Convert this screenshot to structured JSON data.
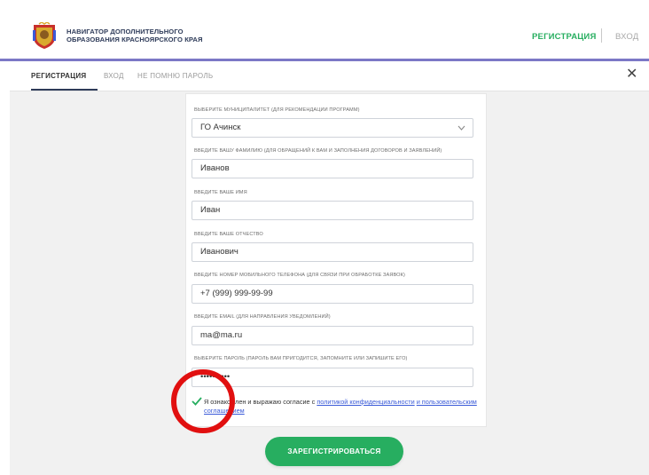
{
  "header": {
    "logo_line1": "НАВИГАТОР ДОПОЛНИТЕЛЬНОГО",
    "logo_line2": "ОБРАЗОВАНИЯ КРАСНОЯРСКОГО КРАЯ",
    "nav_register": "РЕГИСТРАЦИЯ",
    "nav_login": "ВХОД"
  },
  "tabs": {
    "register": "РЕГИСТРАЦИЯ",
    "login": "ВХОД",
    "forgot": "НЕ ПОМНЮ ПАРОЛЬ",
    "close": "✕"
  },
  "form": {
    "municipality": {
      "label": "ВЫБЕРИТЕ МУНИЦИПАЛИТЕТ (ДЛЯ РЕКОМЕНДАЦИИ ПРОГРАММ)",
      "value": "ГО Ачинск"
    },
    "last_name": {
      "label": "ВВЕДИТЕ ВАШУ ФАМИЛИЮ (ДЛЯ ОБРАЩЕНИЙ К ВАМ И ЗАПОЛНЕНИЯ ДОГОВОРОВ И ЗАЯВЛЕНИЙ)",
      "value": "Иванов"
    },
    "first_name": {
      "label": "ВВЕДИТЕ ВАШЕ ИМЯ",
      "value": "Иван"
    },
    "patronymic": {
      "label": "ВВЕДИТЕ ВАШЕ ОТЧЕСТВО",
      "value": "Иванович"
    },
    "phone": {
      "label": "ВВЕДИТЕ НОМЕР МОБИЛЬНОГО ТЕЛЕФОНА (ДЛЯ СВЯЗИ ПРИ ОБРАБОТКЕ ЗАЯВОК)",
      "value": "+7 (999) 999-99-99"
    },
    "email": {
      "label": "ВВЕДИТЕ EMAIL (ДЛЯ НАПРАВЛЕНИЯ УВЕДОМЛЕНИЙ)",
      "value": "ma@ma.ru"
    },
    "password": {
      "label": "ВЫБЕРИТЕ ПАРОЛЬ (ПАРОЛЬ ВАМ ПРИГОДИТСЯ, ЗАПОМНИТЕ ИЛИ ЗАПИШИТЕ ЕГО)",
      "value": "••••••••••"
    },
    "consent": {
      "checked": true,
      "text": "Я ознакомлен и выражаю согласие с ",
      "link1": "политикой конфиденциальности",
      "and": " ",
      "link2": "и пользовательским соглашением"
    },
    "submit": "ЗАРЕГИСТРИРОВАТЬСЯ"
  },
  "colors": {
    "accent_green": "#27ae60",
    "header_line": "#7c78c6",
    "link_blue": "#3b5bd8",
    "annotation_red": "#e11010"
  },
  "icons": {
    "logo": "krasnoyarsk-coat-of-arms-icon",
    "chevron": "chevron-down-icon",
    "check": "check-icon",
    "close": "close-icon"
  }
}
